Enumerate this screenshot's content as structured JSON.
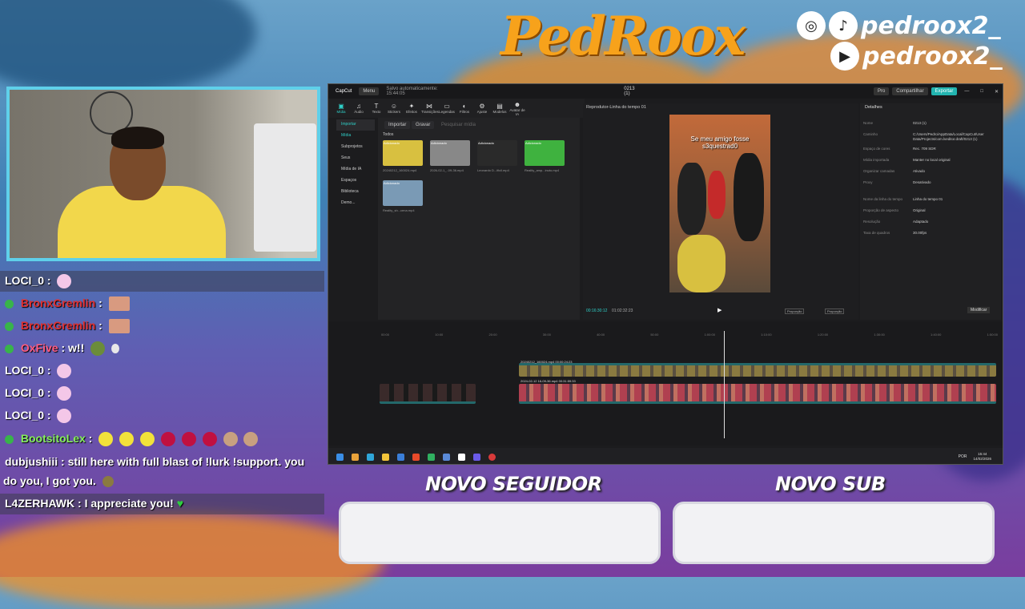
{
  "brand": {
    "logo_text": "PedRoox"
  },
  "social": {
    "handle1": "pedroox2_",
    "handle2": "pedroox2_",
    "icons": [
      "instagram-icon",
      "tiktok-icon",
      "youtube-icon"
    ]
  },
  "chat": {
    "messages": [
      {
        "user": "LOCI_0",
        "text": "",
        "color": "#ffffff",
        "verified": false
      },
      {
        "user": "BronxGremlin",
        "text": "",
        "color": "#e03030",
        "verified": true
      },
      {
        "user": "BronxGremlin",
        "text": "",
        "color": "#e03030",
        "verified": true
      },
      {
        "user": "OxFive",
        "text": "w!!",
        "color": "#ff5b7f",
        "verified": true
      },
      {
        "user": "LOCI_0",
        "text": "",
        "color": "#ffffff",
        "verified": false
      },
      {
        "user": "LOCI_0",
        "text": "",
        "color": "#ffffff",
        "verified": false
      },
      {
        "user": "LOCI_0",
        "text": "",
        "color": "#ffffff",
        "verified": false
      },
      {
        "user": "BootsitoLex",
        "text": "",
        "color": "#86f05c",
        "verified": true
      },
      {
        "user": "dubjushiii",
        "text": "still here with full blast of !lurk !support. you",
        "cont": "do you, I got you.",
        "color": "#ffffff",
        "verified": false
      },
      {
        "user": "L4ZERHAWK",
        "text": "I appreciate you!",
        "color": "#ffffff",
        "verified": false
      }
    ]
  },
  "app": {
    "title": "0213 (1)",
    "logo": "CapCut",
    "menu": "Menu",
    "autosave": "Salvo automaticamente: 15:44:05",
    "pro": "Pro",
    "share": "Compartilhar",
    "export": "Exportar",
    "tools": [
      "Mídia",
      "Áudio",
      "Texto",
      "Stickers",
      "Efeitos",
      "Transições",
      "Legendas",
      "Filtros",
      "Ajuste",
      "Modelos",
      "Avatar de IA"
    ],
    "sidebar": [
      "Importar",
      "Mídia",
      "Subprojetos",
      "Seus",
      "Mídia de IA",
      "Espaços",
      "Biblioteca",
      "Demo..."
    ],
    "media_bar": {
      "import": "Importar",
      "record": "Gravar",
      "search": "Pesquisar mídia"
    },
    "media_all": "Todos",
    "thumbs": [
      {
        "tag": "Adicionado",
        "dur": "00:23",
        "label": "20240212_160024.mp4",
        "color": "#d8c040"
      },
      {
        "tag": "Adicionado",
        "dur": "02:35",
        "label": "2026-02-1_..09-36.mp4",
        "color": "#888888"
      },
      {
        "tag": "Adicionado",
        "dur": "00:21",
        "label": "Leonardo D...ificil.mp4",
        "color": "#2a2a2a"
      },
      {
        "tag": "Adicionado",
        "dur": "00:11",
        "label": "Reality_amp...inuto.mp4",
        "color": "#3fb23f"
      },
      {
        "tag": "Adicionado",
        "dur": "",
        "label": "Reality_sh...cena.mp4",
        "color": "#7a9ab5"
      }
    ],
    "player": {
      "title": "Reprodutor-Linha do tempo 01",
      "caption": "Se meu amigo fosse s3questrad0",
      "time_current": "00:16:30:12",
      "time_total": "01:02:32:23",
      "btn_quality": "Proporção",
      "btn_ratio": "Proporção"
    },
    "details": {
      "title": "Detalhes",
      "rows": [
        {
          "k": "Nome",
          "v": "0213 (1)"
        },
        {
          "k": "Caminho",
          "v": "C:/Users/Pedro/AppData/Local/CapCut/User"
        },
        {
          "k": "",
          "v": "Data/Projects/com.lveditor.draft/0213 (1)"
        },
        {
          "k": "Espaço de cores",
          "v": "Rec. 709 SDR"
        },
        {
          "k": "Mídia importada",
          "v": "Manter no local original"
        },
        {
          "k": "Organizar camadas",
          "v": "Ativado"
        },
        {
          "k": "Proxy",
          "v": "Desativado"
        },
        {
          "k": "Nome da linha do tempo",
          "v": "Linha do tempo 01"
        },
        {
          "k": "Proporção de aspecto",
          "v": "Original"
        },
        {
          "k": "Resolução",
          "v": "Adaptado"
        },
        {
          "k": "Taxa de quadros",
          "v": "30.00fps"
        }
      ],
      "modify": "Modificar"
    },
    "timeline": {
      "ruler": [
        "00:00",
        "10:00",
        "20:00",
        "30:00",
        "40:00",
        "50:00",
        "1:00:00",
        "1:10:00",
        "1:20:00",
        "1:30:00",
        "1:40:00",
        "1:50:00"
      ],
      "clip1_label": "20240212_160024.mp4  00:00:24:23",
      "clip2_label": "2024-02-12 16-09-36.mp4  00:31:59:33"
    },
    "taskbar": {
      "lang": "POR",
      "time": "15:44",
      "date": "14/02/2026"
    }
  },
  "alerts": {
    "follower_title": "NOVO SEGUIDOR",
    "sub_title": "NOVO SUB"
  }
}
